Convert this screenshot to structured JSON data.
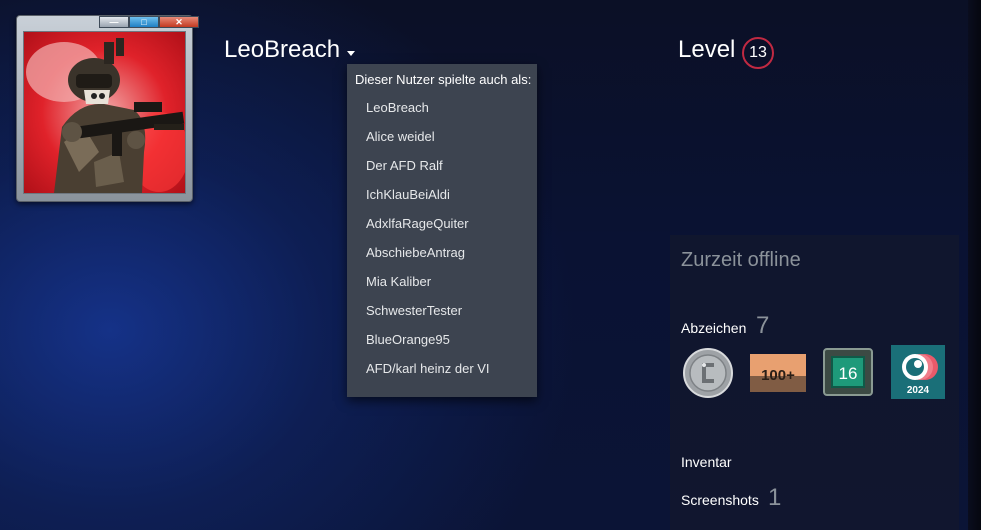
{
  "profile": {
    "persona_name": "LeoBreach",
    "level_label": "Level",
    "level": "13"
  },
  "window_controls": {
    "minimize": "—",
    "maximize": "□",
    "close": "✕"
  },
  "alias_dropdown": {
    "header": "Dieser Nutzer spielte auch als:",
    "items": [
      "LeoBreach",
      "Alice weidel",
      "Der AFD Ralf",
      "IchKlauBeiAldi",
      "AdxlfaRageQuiter",
      "AbschiebeAntrag",
      "Mia Kaliber",
      "SchwesterTester",
      "BlueOrange95",
      "AFD/karl heinz der VI"
    ]
  },
  "sidebar": {
    "status": "Zurzeit offline",
    "badges_label": "Abzeichen",
    "badges_count": "7",
    "badges": [
      {
        "icon": "silver-coin-badge-icon"
      },
      {
        "icon": "100-plus-badge-icon",
        "text": "100+"
      },
      {
        "icon": "years-of-service-badge-icon",
        "text": "16"
      },
      {
        "icon": "steam-replay-badge-icon",
        "text": "2024"
      }
    ],
    "inventory_label": "Inventar",
    "screenshots_label": "Screenshots",
    "screenshots_count": "1"
  },
  "colors": {
    "level_ring": "#c02942",
    "dropdown_bg": "#3d4450",
    "offline_text": "#8b929a"
  }
}
